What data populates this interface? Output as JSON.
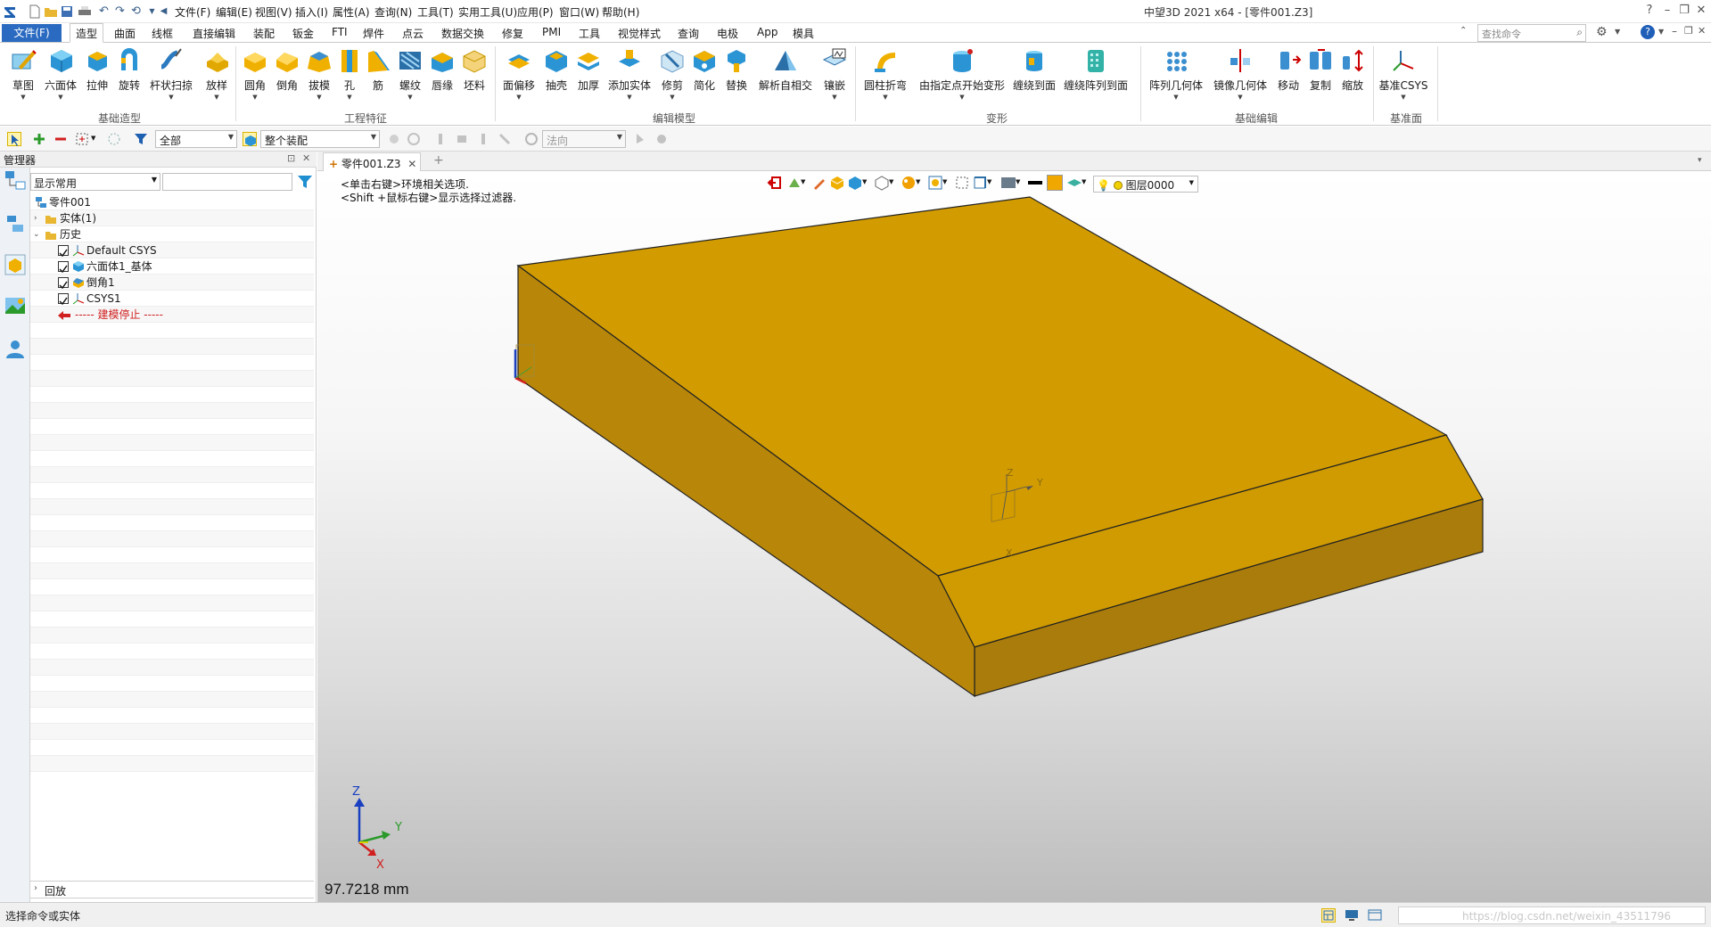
{
  "title_bar": {
    "window_title": "中望3D 2021 x64 - [零件001.Z3]",
    "menus": [
      "文件(F)",
      "编辑(E)",
      "视图(V)",
      "插入(I)",
      "属性(A)",
      "查询(N)",
      "工具(T)",
      "实用工具(U)",
      "应用(P)",
      "窗口(W)",
      "帮助(H)"
    ],
    "quick_access_icons": [
      "new-file-icon",
      "open-folder-icon",
      "save-icon",
      "print-icon",
      "undo-icon",
      "redo-icon",
      "refresh-icon",
      "back-icon"
    ]
  },
  "ribbon_tabs": {
    "file": "文件(F)",
    "tabs": [
      "造型",
      "曲面",
      "线框",
      "直接编辑",
      "装配",
      "钣金",
      "FTI",
      "焊件",
      "点云",
      "数据交换",
      "修复",
      "PMI",
      "工具",
      "视觉样式",
      "查询",
      "电极",
      "App",
      "模具"
    ],
    "active": "造型",
    "search_placeholder": "查找命令"
  },
  "ribbon": {
    "groups": [
      {
        "name": "基础造型",
        "buttons": [
          "草图",
          "六面体",
          "拉伸",
          "旋转",
          "杆状扫掠",
          "放样"
        ]
      },
      {
        "name": "工程特征",
        "buttons": [
          "圆角",
          "倒角",
          "拔模",
          "孔",
          "筋",
          "螺纹",
          "唇缘",
          "坯料"
        ]
      },
      {
        "name": "编辑模型",
        "buttons": [
          "面偏移",
          "抽壳",
          "加厚",
          "添加实体",
          "修剪",
          "简化",
          "替换",
          "解析自相交",
          "镶嵌"
        ]
      },
      {
        "name": "变形",
        "buttons": [
          "圆柱折弯",
          "由指定点开始变形",
          "缠绕到面",
          "缠绕阵列到面"
        ]
      },
      {
        "name": "基础编辑",
        "buttons": [
          "阵列几何体",
          "镜像几何体",
          "移动",
          "复制",
          "缩放"
        ]
      },
      {
        "name": "基准面",
        "buttons": [
          "基准CSYS"
        ]
      }
    ]
  },
  "toolbar": {
    "filter_value": "全部",
    "assembly_value": "整个装配",
    "direction_placeholder": "法向"
  },
  "manager": {
    "title": "管理器",
    "filter_value": "显示常用",
    "tree": [
      {
        "label": "零件001",
        "level": 0
      },
      {
        "label": "实体(1)",
        "level": 1
      },
      {
        "label": "历史",
        "level": 1
      },
      {
        "label": "Default CSYS",
        "level": 2
      },
      {
        "label": "六面体1_基体",
        "level": 2
      },
      {
        "label": "倒角1",
        "level": 2
      },
      {
        "label": "CSYS1",
        "level": 2
      },
      {
        "label": "----- 建模停止 -----",
        "level": 2
      }
    ],
    "playback": "回放"
  },
  "document": {
    "tab": "零件001.Z3",
    "hint_1": "<单击右键>环境相关选项.",
    "hint_2": "<Shift +鼠标右键>显示选择过滤器.",
    "measurement": "97.7218 mm",
    "layer": "图层0000",
    "axis_labels": {
      "x": "X",
      "y": "Y",
      "z": "Z"
    }
  },
  "status": {
    "text": "选择命令或实体",
    "watermark": "https://blog.csdn.net/weixin_43511796"
  },
  "colors": {
    "solid_top": "#d09b00",
    "solid_front": "#b8870a",
    "solid_side": "#a97c0b",
    "file_tab": "#2a6ac0"
  }
}
